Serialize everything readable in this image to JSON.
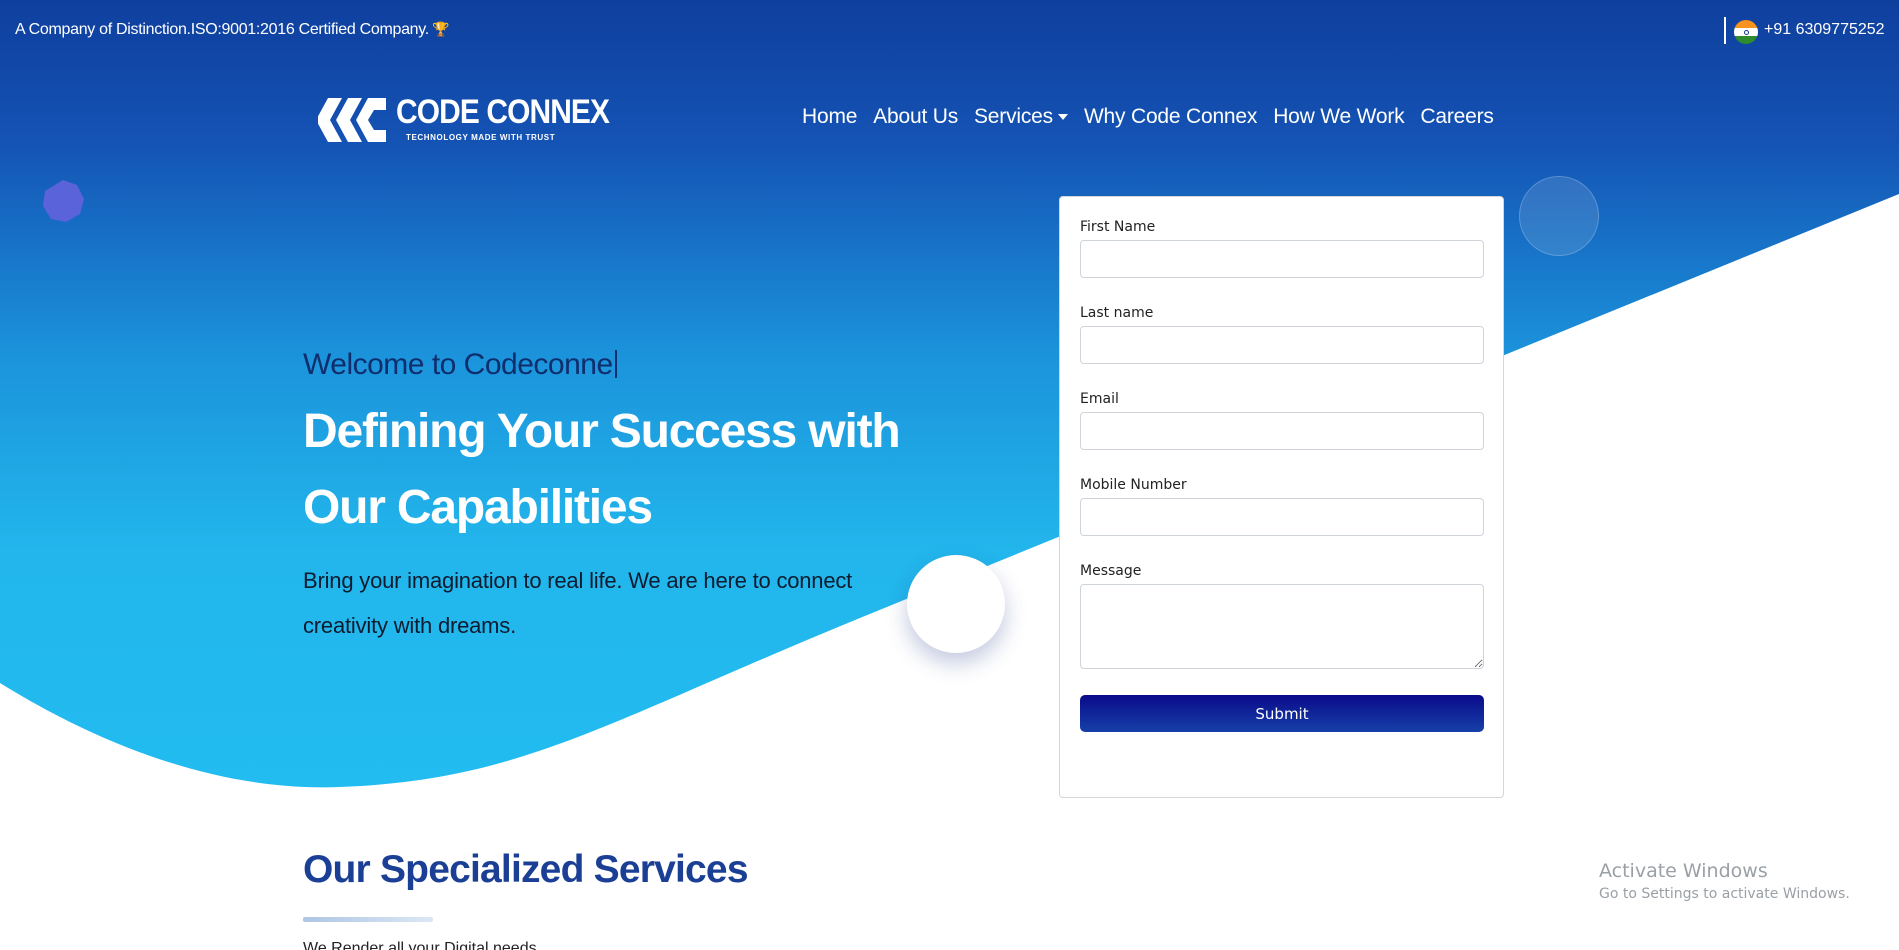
{
  "topbar": {
    "tagline": "A Company of Distinction.ISO:9001:2016 Certified Company.",
    "trophy_icon": "trophy-icon",
    "flag_icon": "india-flag-icon",
    "phone": "+91 6309775252"
  },
  "logo": {
    "brand": "CODE CONNEX",
    "tagline": "TECHNOLOGY MADE WITH TRUST"
  },
  "nav": {
    "items": [
      {
        "label": "Home"
      },
      {
        "label": "About Us"
      },
      {
        "label": "Services"
      },
      {
        "label": "Why Code Connex"
      },
      {
        "label": "How We Work"
      },
      {
        "label": "Careers"
      }
    ]
  },
  "hero": {
    "welcome": "Welcome to Codeconne",
    "headline_line1": "Defining Your Success with",
    "headline_line2": "Our Capabilities",
    "lead_line1": "Bring your imagination to real life. We are here to connect",
    "lead_line2": "creativity with dreams."
  },
  "form": {
    "fields": [
      {
        "label": "First Name",
        "value": ""
      },
      {
        "label": "Last name",
        "value": ""
      },
      {
        "label": "Email",
        "value": ""
      },
      {
        "label": "Mobile Number",
        "value": ""
      },
      {
        "label": "Message",
        "value": ""
      }
    ],
    "submit_label": "Submit"
  },
  "section": {
    "title": "Our Specialized Services",
    "subtitle": "We Render all your Digital needs"
  },
  "watermark": {
    "line1": "Activate Windows",
    "line2": "Go to Settings to activate Windows."
  },
  "colors": {
    "top_blue": "#0f3f9e",
    "light_blue": "#22b6ec",
    "title_blue": "#1a3f94",
    "submit_dark": "#0a0a8a"
  }
}
